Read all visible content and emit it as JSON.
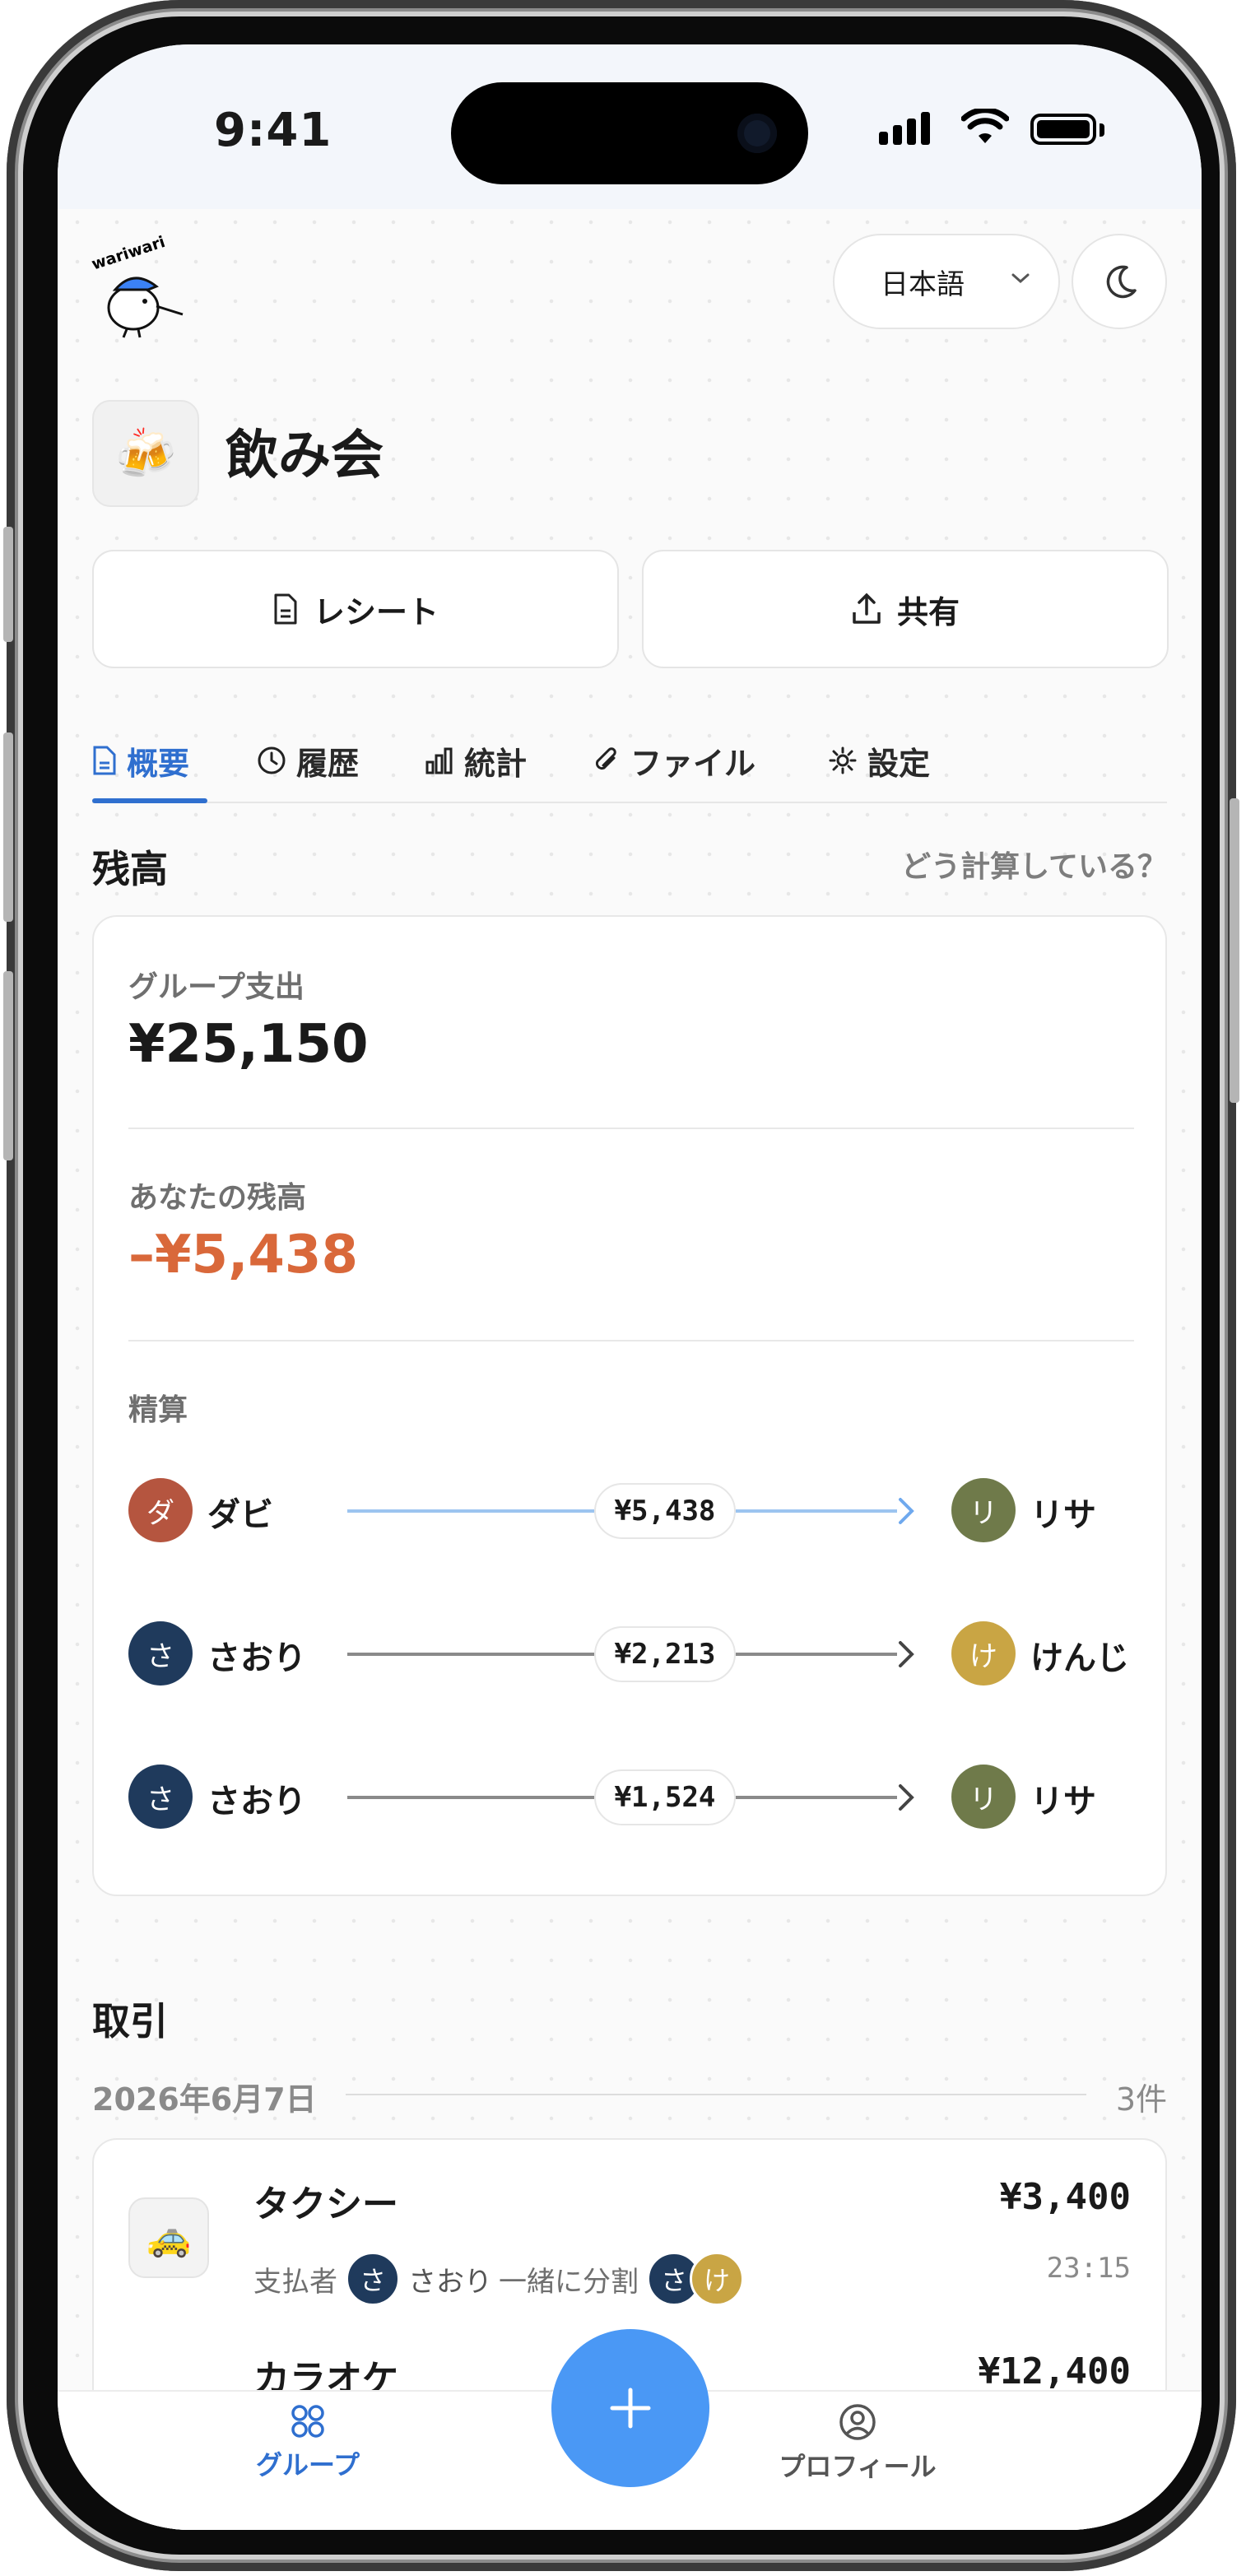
{
  "status": {
    "time": "9:41"
  },
  "header": {
    "language": "日本語"
  },
  "group": {
    "icon": "🍻",
    "title": "飲み会"
  },
  "actions": {
    "receipt": "レシート",
    "share": "共有"
  },
  "tabs": [
    {
      "label": "概要",
      "icon": "document-icon"
    },
    {
      "label": "履歴",
      "icon": "clock-icon"
    },
    {
      "label": "統計",
      "icon": "bar-chart-icon"
    },
    {
      "label": "ファイル",
      "icon": "paperclip-icon"
    },
    {
      "label": "設定",
      "icon": "gear-icon"
    }
  ],
  "balance": {
    "section_title": "残高",
    "help_link": "どう計算している？",
    "group_spend_label": "グループ支出",
    "group_spend": "¥25,150",
    "your_balance_label": "あなたの残高",
    "your_balance": "–¥5,438",
    "settlement_label": "精算",
    "settlements": [
      {
        "from": "ダビ",
        "from_initial": "ダ",
        "from_color": "#b5553f",
        "amount": "¥5,438",
        "to": "リサ",
        "to_initial": "リ",
        "to_color": "#6f7a4a",
        "highlight": true
      },
      {
        "from": "さおり",
        "from_initial": "さ",
        "from_color": "#1f3a5c",
        "amount": "¥2,213",
        "to": "けんじ",
        "to_initial": "け",
        "to_color": "#c9a544",
        "highlight": false
      },
      {
        "from": "さおり",
        "from_initial": "さ",
        "from_color": "#1f3a5c",
        "amount": "¥1,524",
        "to": "リサ",
        "to_initial": "リ",
        "to_color": "#6f7a4a",
        "highlight": false
      }
    ]
  },
  "transactions": {
    "section_title": "取引",
    "date": "2026年6月7日",
    "count": "3件",
    "items": [
      {
        "title": "タクシー",
        "icon": "🚕",
        "amount": "¥3,400",
        "time": "23:15",
        "payer_label": "支払者",
        "payer_initial": "さ",
        "payer": "さおり",
        "split_label": "一緒に分割",
        "split_initials": [
          "さ",
          "け"
        ]
      },
      {
        "title": "カラオケ",
        "icon": "🎤",
        "amount": "¥12,400"
      }
    ]
  },
  "bottom_nav": {
    "groups": "グループ",
    "profile": "プロフィール"
  },
  "colors": {
    "accent": "#2f6fcf",
    "negative": "#d9683a",
    "fab": "#4a98f5"
  }
}
